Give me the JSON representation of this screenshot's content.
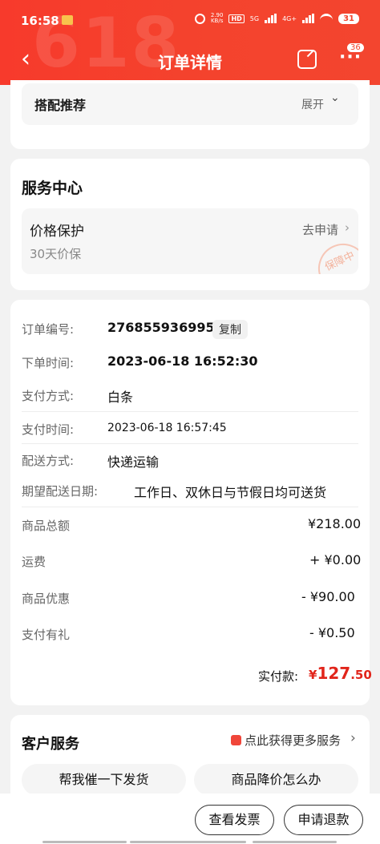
{
  "status_bar": {
    "time": "16:58",
    "net_speed": "2.90",
    "net_unit": "KB/s",
    "hd": "HD",
    "network": "5G",
    "network2": "4G+",
    "battery": "31"
  },
  "nav": {
    "title": "订单详情",
    "back_icon": "chevron-left-icon",
    "more_badge": "36"
  },
  "header_decor": "618",
  "recommend": {
    "label": "搭配推荐",
    "toggle": "展开"
  },
  "service_center": {
    "title": "服务中心",
    "price_protect": {
      "title": "价格保护",
      "subtitle": "30天价保",
      "action": "去申请",
      "stamp": "保障中"
    }
  },
  "order_info": {
    "order_no_label": "订单编号:",
    "order_no": "276855936995",
    "copy": "复制",
    "order_time_label": "下单时间:",
    "order_time": "2023-06-18 16:52:30",
    "pay_method_label": "支付方式:",
    "pay_method": "白条",
    "pay_time_label": "支付时间:",
    "pay_time": "2023-06-18 16:57:45",
    "delivery_label": "配送方式:",
    "delivery": "快递运输",
    "expected_label": "期望配送日期:",
    "expected": "工作日、双休日与节假日均可送货",
    "total_label": "商品总额",
    "total": "¥218.00",
    "freight_label": "运费",
    "freight": "+ ¥0.00",
    "discount_label": "商品优惠",
    "discount": "- ¥90.00",
    "gift_label": "支付有礼",
    "gift": "- ¥0.50",
    "paid_label": "实付款:",
    "paid_symbol": "¥",
    "paid_int": "127",
    "paid_dec": ".50"
  },
  "customer_service": {
    "title": "客户服务",
    "more": "点此获得更多服务",
    "btn1": "帮我催一下发货",
    "btn2": "商品降价怎么办"
  },
  "bottom": {
    "invoice": "查看发票",
    "refund": "申请退款"
  },
  "colors": {
    "header": "#f43f2d",
    "price_red": "#e1251b"
  }
}
